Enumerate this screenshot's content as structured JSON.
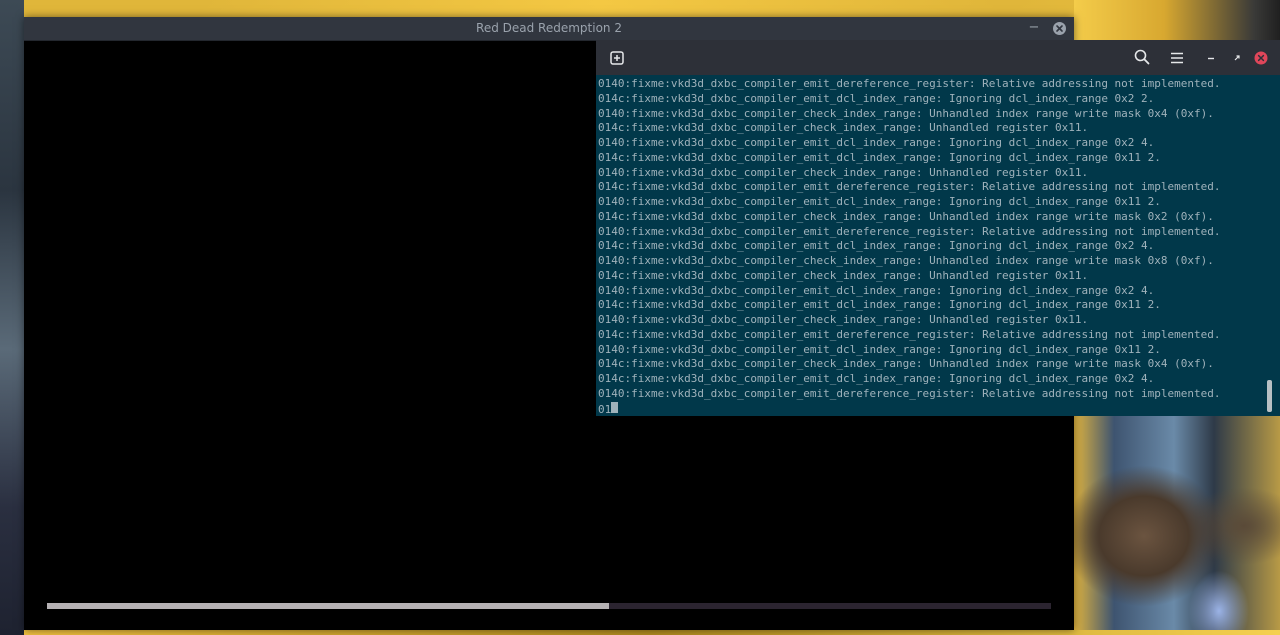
{
  "game_window": {
    "title": "Red Dead Redemption 2",
    "minimize_symbol": "−",
    "loading_progress": 0.56
  },
  "terminal": {
    "icons": {
      "new_tab": "new-tab-icon",
      "search": "search-icon",
      "menu": "hamburger-menu-icon",
      "minimize": "minimize-icon",
      "maximize": "maximize-icon",
      "close": "close-icon"
    },
    "lines": [
      "0140:fixme:vkd3d_dxbc_compiler_emit_dereference_register: Relative addressing not implemented.",
      "014c:fixme:vkd3d_dxbc_compiler_emit_dcl_index_range: Ignoring dcl_index_range 0x2 2.",
      "0140:fixme:vkd3d_dxbc_compiler_check_index_range: Unhandled index range write mask 0x4 (0xf).",
      "014c:fixme:vkd3d_dxbc_compiler_check_index_range: Unhandled register 0x11.",
      "0140:fixme:vkd3d_dxbc_compiler_emit_dcl_index_range: Ignoring dcl_index_range 0x2 4.",
      "014c:fixme:vkd3d_dxbc_compiler_emit_dcl_index_range: Ignoring dcl_index_range 0x11 2.",
      "0140:fixme:vkd3d_dxbc_compiler_check_index_range: Unhandled register 0x11.",
      "014c:fixme:vkd3d_dxbc_compiler_emit_dereference_register: Relative addressing not implemented.",
      "0140:fixme:vkd3d_dxbc_compiler_emit_dcl_index_range: Ignoring dcl_index_range 0x11 2.",
      "014c:fixme:vkd3d_dxbc_compiler_check_index_range: Unhandled index range write mask 0x2 (0xf).",
      "0140:fixme:vkd3d_dxbc_compiler_emit_dereference_register: Relative addressing not implemented.",
      "014c:fixme:vkd3d_dxbc_compiler_emit_dcl_index_range: Ignoring dcl_index_range 0x2 4.",
      "0140:fixme:vkd3d_dxbc_compiler_check_index_range: Unhandled index range write mask 0x8 (0xf).",
      "014c:fixme:vkd3d_dxbc_compiler_check_index_range: Unhandled register 0x11.",
      "0140:fixme:vkd3d_dxbc_compiler_emit_dcl_index_range: Ignoring dcl_index_range 0x2 4.",
      "014c:fixme:vkd3d_dxbc_compiler_emit_dcl_index_range: Ignoring dcl_index_range 0x11 2.",
      "0140:fixme:vkd3d_dxbc_compiler_check_index_range: Unhandled register 0x11.",
      "014c:fixme:vkd3d_dxbc_compiler_emit_dereference_register: Relative addressing not implemented.",
      "0140:fixme:vkd3d_dxbc_compiler_emit_dcl_index_range: Ignoring dcl_index_range 0x11 2.",
      "014c:fixme:vkd3d_dxbc_compiler_check_index_range: Unhandled index range write mask 0x4 (0xf).",
      "014c:fixme:vkd3d_dxbc_compiler_emit_dcl_index_range: Ignoring dcl_index_range 0x2 4.",
      "0140:fixme:vkd3d_dxbc_compiler_emit_dereference_register: Relative addressing not implemented."
    ],
    "prompt_partial": "01"
  },
  "colors": {
    "terminal_bg": "#01384a",
    "terminal_text": "#9fb2bb",
    "header_bg": "#2d3038",
    "close_accent": "#e0465a"
  }
}
